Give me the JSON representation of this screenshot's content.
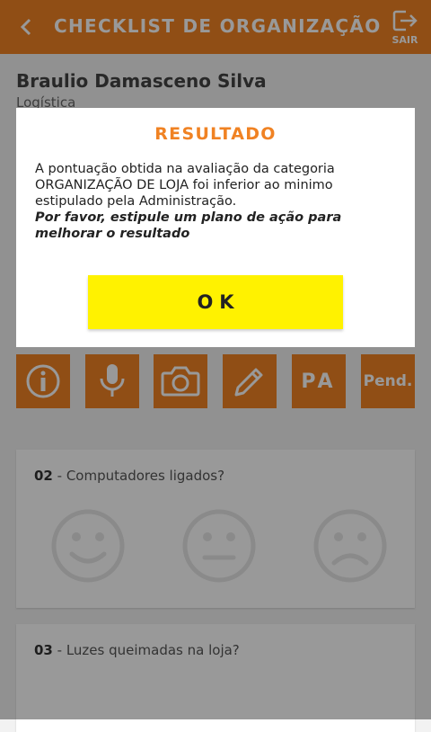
{
  "header": {
    "title": "CHECKLIST DE ORGANIZAÇÃO",
    "exit_label": "SAIR",
    "back_icon": "chevron-left-icon"
  },
  "user": {
    "name": "Braulio Damasceno Silva",
    "department": "Logística"
  },
  "toolbar": {
    "pa_label": "PA",
    "pending_label": "Pend."
  },
  "questions": [
    {
      "number": "02",
      "text": " - Computadores ligados?"
    },
    {
      "number": "03",
      "text": " - Luzes queimadas na loja?"
    }
  ],
  "dialog": {
    "title": "RESULTADO",
    "message": "A pontuação obtida na avaliação da categoria ORGANIZAÇÃO DE LOJA foi inferior ao minimo estipulado pela Administração.",
    "note": "Por favor, estipule um plano de ação para melhorar o resultado",
    "ok_label": "OK"
  },
  "colors": {
    "accent": "#f08223",
    "button": "#fff200",
    "face": "#e6e6e6"
  }
}
